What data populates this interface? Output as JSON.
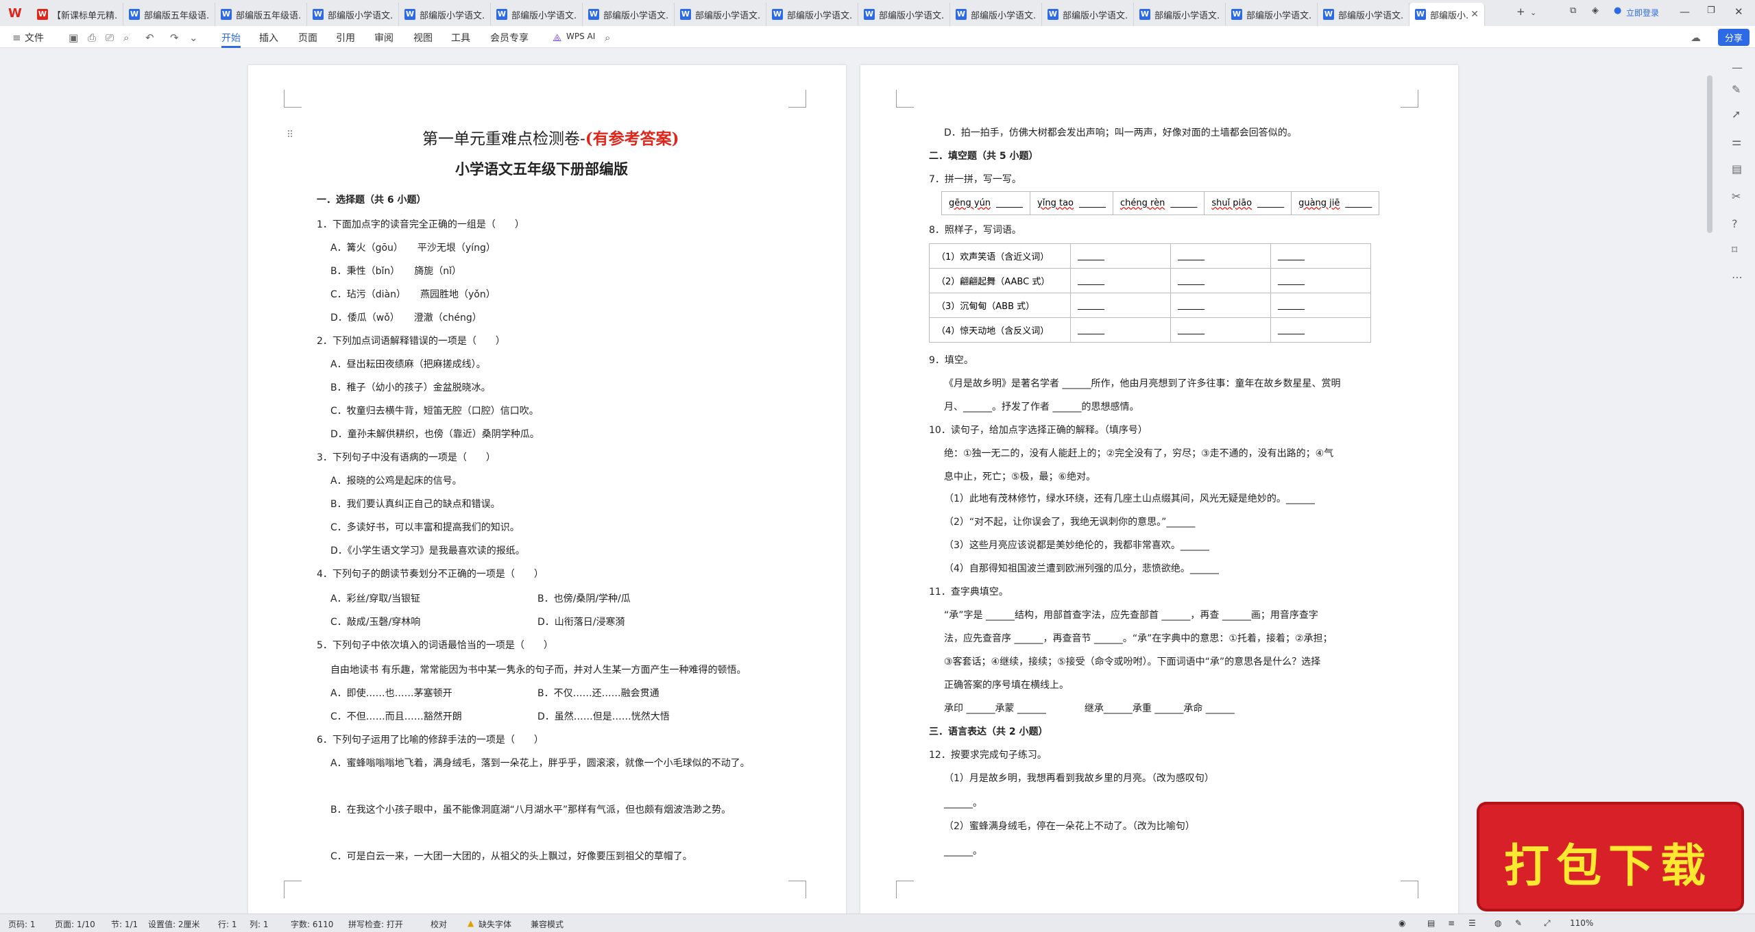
{
  "tabs": [
    "【新课标单元精...",
    "部编版五年级语...",
    "部编版五年级语...",
    "部编版小学语文...",
    "部编版小学语文...",
    "部编版小学语文...",
    "部编版小学语文...",
    "部编版小学语文...",
    "部编版小学语文...",
    "部编版小学语文...",
    "部编版小学语文...",
    "部编版小学语文...",
    "部编版小学语文...",
    "部编版小学语文...",
    "部编版小学语文..."
  ],
  "active_tab": "部编版小...",
  "login": "立即登录",
  "ribbon": {
    "file": "文件",
    "items": [
      "开始",
      "插入",
      "页面",
      "引用",
      "审阅",
      "视图",
      "工具",
      "会员专享"
    ],
    "ai": "WPS AI",
    "share": "分享"
  },
  "page1": {
    "title_a": "第一单元重难点检测卷-",
    "title_b": "(有参考答案)",
    "subtitle": "小学语文五年级下册部编版",
    "lines": [
      "一．选择题（共 6 小题）",
      "1．下面加点字的读音完全正确的一组是（　　）",
      "A．篝火（gōu）　　平沙无垠（yíng）",
      "B．秉性（bǐn）　　旖旎（nǐ）",
      "C．玷污（diàn）　　燕园胜地（yǒn）",
      "D．倭瓜（wǒ）　　澄澈（chéng）",
      "2．下列加点词语解释错误的一项是（　　）",
      "A．昼出耘田夜绩麻（把麻搓成线）。",
      "B．稚子（幼小的孩子）金盆脱晓冰。",
      "C．牧童归去横牛背，短笛无腔（口腔）信口吹。",
      "D．童孙未解供耕织，也傍（靠近）桑阴学种瓜。",
      "3．下列句子中没有语病的一项是（　　）",
      "A．报晓的公鸡是起床的信号。",
      "B．我们要认真纠正自己的缺点和错误。",
      "C．多读好书，可以丰富和提高我们的知识。",
      "D．《小学生语文学习》是我最喜欢读的报纸。",
      "4．下列句子的朗读节奏划分不正确的一项是（　　）",
      "A．彩丝/穿取/当银钲",
      "B．也傍/桑阴/学种/瓜",
      "C．敲成/玉磬/穿林响",
      "D．山衔落日/浸寒漪",
      "5．下列句子中依次填入的词语最恰当的一项是（　　）",
      "自由地读书 有乐趣，常常能因为书中某一隽永的句子而，并对人生某一方面产生一种难得的顿悟。",
      "A．即使……也……茅塞顿开",
      "B．不仅……还……融会贯通",
      "C．不但……而且……豁然开朗",
      "D．虽然……但是……恍然大悟",
      "6．下列句子运用了比喻的修辞手法的一项是（　　）",
      "A．蜜蜂嗡嗡嗡地飞着，满身绒毛，落到一朵花上，胖乎乎，圆滚滚，就像一个小毛球似的不动了。",
      "B．在我这个小孩子眼中，虽不能像洞庭湖“八月湖水平”那样有气派，但也颇有烟波浩渺之势。",
      "C．可是白云一来，一大团一大团的，从祖父的头上飘过，好像要压到祖父的草帽了。"
    ]
  },
  "page2": {
    "lines": [
      "D．拍一拍手，仿佛大树都会发出声响；叫一两声，好像对面的土墙都会回答似的。",
      "二．填空题（共 5 小题）",
      "7．拼一拼，写一写。",
      "8．照样子，写词语。",
      "9．填空。",
      "《月是故乡明》是著名学者 ______所作，他由月亮想到了许多往事：童年在故乡数星星、赏明",
      "月、______。抒发了作者 ______的思想感情。",
      "10．读句子，给加点字选择正确的解释。（填序号）",
      "绝：①独一无二的，没有人能赶上的；②完全没有了，穷尽；③走不通的，没有出路的；④气",
      "息中止，死亡；⑤极，最；⑥绝对。",
      "（1）此地有茂林修竹，绿水环绕，还有几座土山点缀其间，风光无疑是绝妙的。______",
      "（2）“对不起，让你误会了，我绝无讽刺你的意思。”______",
      "（3）这些月亮应该说都是美妙绝伦的，我都非常喜欢。______",
      "（4）自那得知祖国波兰遭到欧洲列强的瓜分，悲愤欲绝。______",
      "11．查字典填空。",
      "“承”字是 ______结构，用部首查字法，应先查部首 ______，再查 ______画；用音序查字",
      "法，应先查音序 ______，再查音节 ______。“承”在字典中的意思：①托着，接着；②承担；",
      "③客套话；④继续，接续；⑤接受（命令或吩咐）。下面词语中“承”的意思各是什么？选择",
      "正确答案的序号填在横线上。",
      "承印 ______承蒙 ______　　　　继承______承重 ______承命 ______",
      "三．语言表达（共 2 小题）",
      "12．按要求完成句子练习。",
      "（1）月是故乡明，我想再看到我故乡里的月亮。（改为感叹句）",
      "______。",
      "（2）蜜蜂满身绒毛，停在一朵花上不动了。（改为比喻句）",
      "______。"
    ],
    "pinyin": [
      "gēng yún",
      "yǐng tao",
      "chéng rèn",
      "shuǐ piāo",
      "guàng jiē"
    ],
    "blank": "______",
    "table8": [
      "（1）欢声笑语（含近义词）",
      "（2）翩翩起舞（AABC 式）",
      "（3）沉甸甸（ABB 式）",
      "（4）惊天动地（含反义词）"
    ]
  },
  "status": {
    "page": "页码: 1",
    "pages": "页面: 1/10",
    "section": "节: 1/1",
    "setting": "设置值: 2厘米",
    "row": "行: 1",
    "col": "列: 1",
    "words": "字数: 6110",
    "spell": "拼写检查: 打开",
    "proof": "校对",
    "font": "缺失字体",
    "compat": "兼容模式",
    "zoom": "110%"
  },
  "banner": "打包下载"
}
